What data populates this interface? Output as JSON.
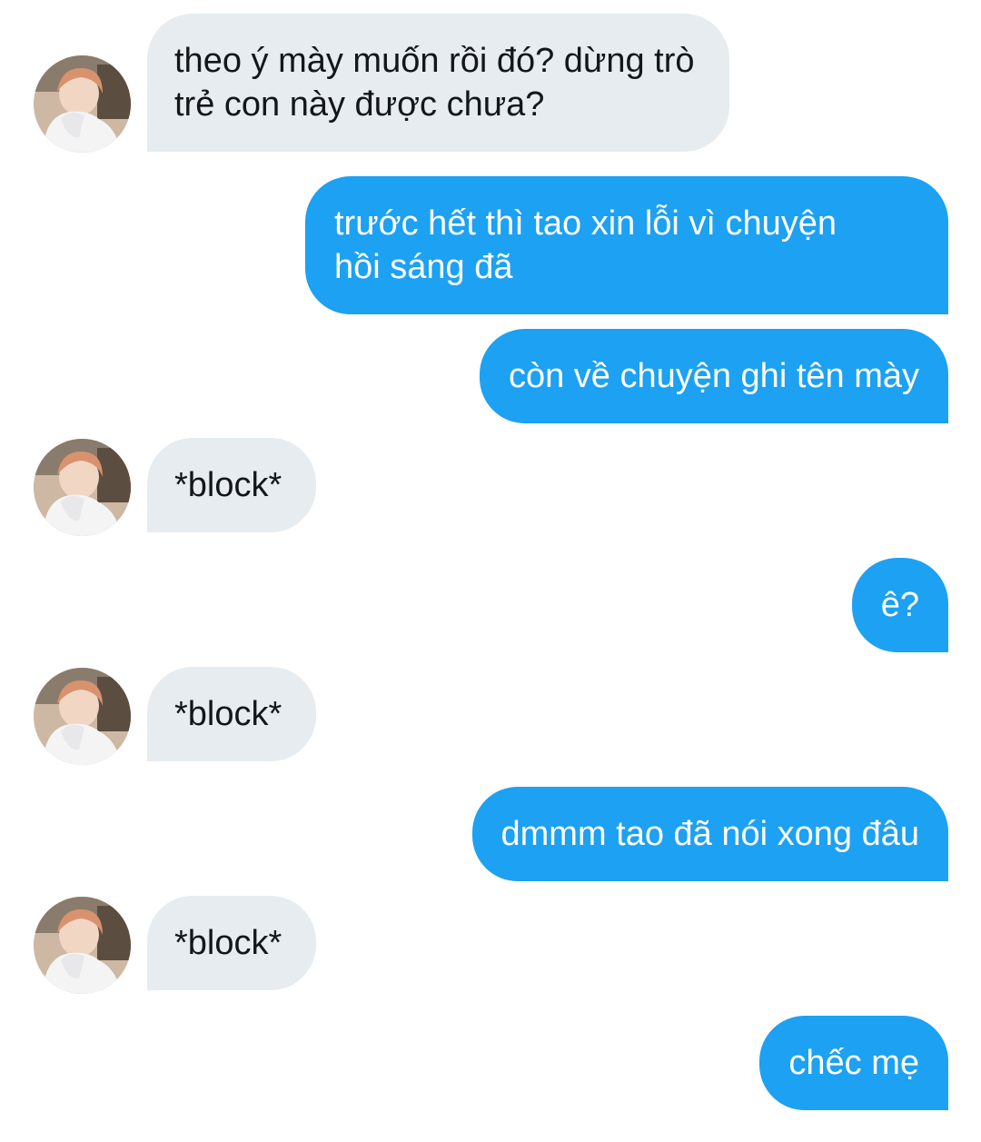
{
  "contact": {
    "avatar_icon": "user-avatar-photo"
  },
  "messages": [
    {
      "direction": "incoming",
      "lines": [
        "theo ý mày muốn rồi đó? dừng trò",
        "trẻ con này được chưa?"
      ]
    },
    {
      "direction": "outgoing",
      "lines": [
        "trước hết thì tao xin lỗi vì chuyện",
        "hồi sáng đã"
      ]
    },
    {
      "direction": "outgoing",
      "lines": [
        "còn về chuyện ghi tên mày"
      ]
    },
    {
      "direction": "incoming",
      "lines": [
        "*block*"
      ]
    },
    {
      "direction": "outgoing",
      "lines": [
        "ê?"
      ]
    },
    {
      "direction": "incoming",
      "lines": [
        "*block*"
      ]
    },
    {
      "direction": "outgoing",
      "lines": [
        "dmmm tao đã nói xong đâu"
      ]
    },
    {
      "direction": "incoming",
      "lines": [
        "*block*"
      ]
    },
    {
      "direction": "outgoing",
      "lines": [
        "chếc mẹ"
      ]
    }
  ],
  "colors": {
    "incoming_bubble": "#e6ecf0",
    "incoming_text": "#14171a",
    "outgoing_bubble": "#1da1f2",
    "outgoing_text": "#ffffff"
  }
}
